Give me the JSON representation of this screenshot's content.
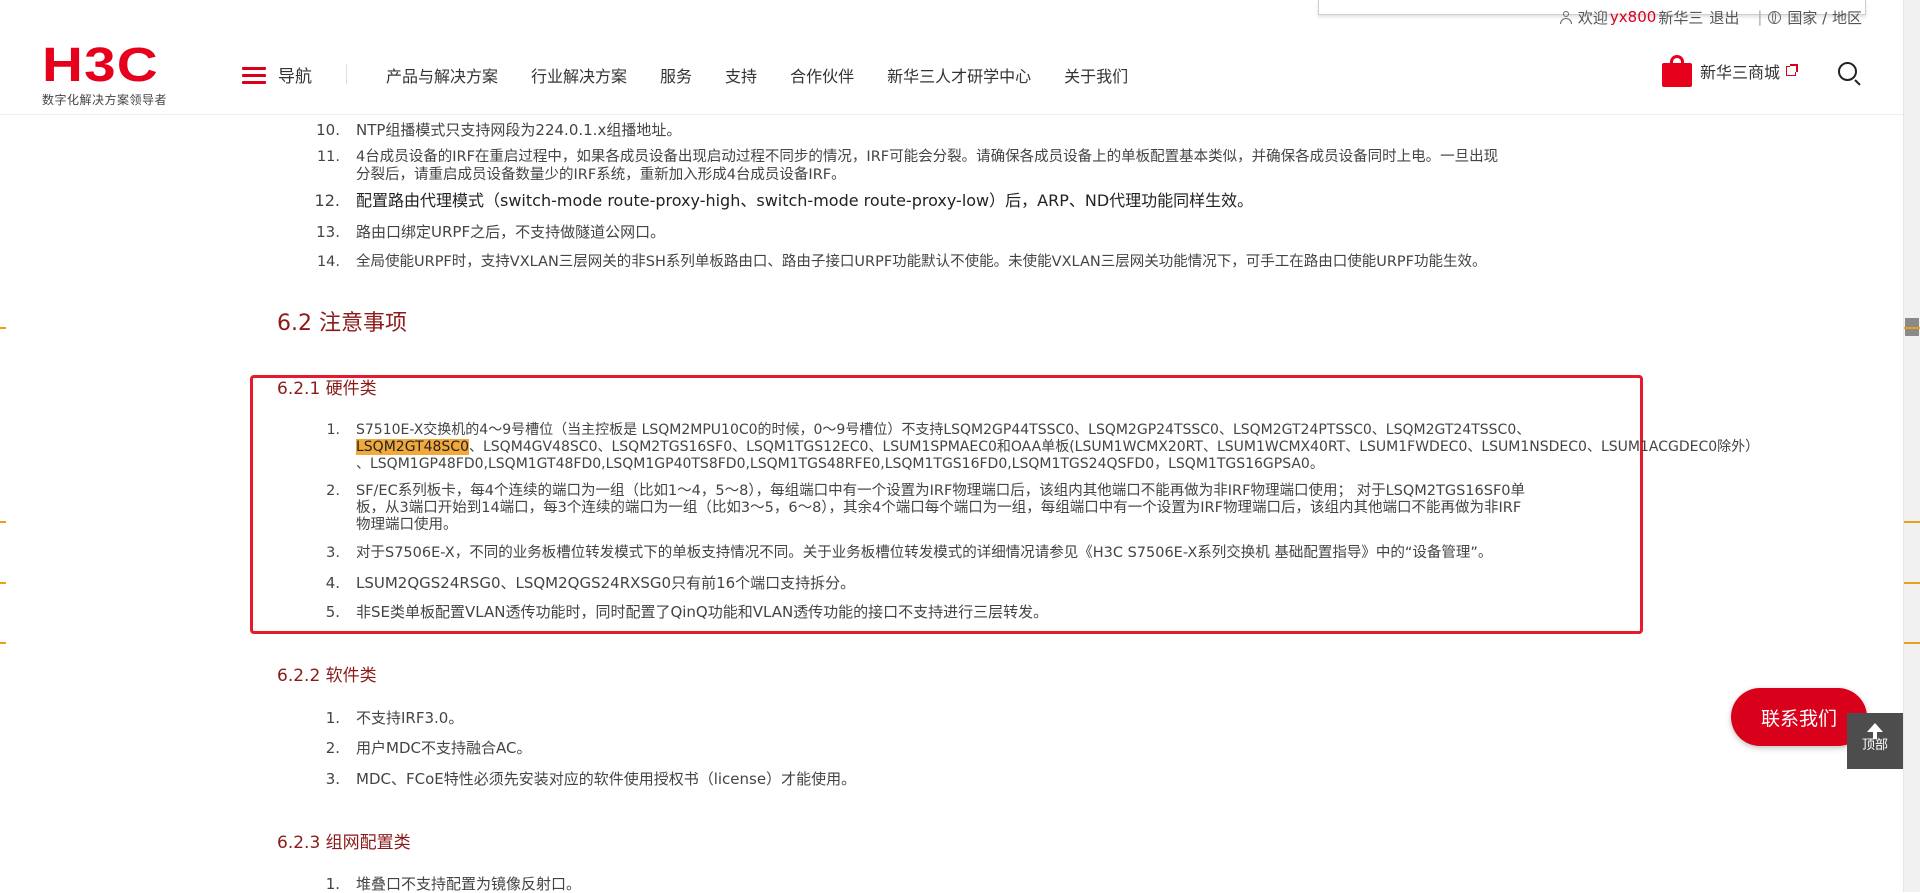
{
  "utility": {
    "welcome": "欢迎",
    "username": "yx800",
    "company": "新华三",
    "logout": "退出",
    "region": "国家 / 地区"
  },
  "header": {
    "logo_text": "H3C",
    "logo_tagline": "数字化解决方案领导者",
    "menu_label": "导航",
    "nav": [
      "产品与解决方案",
      "行业解决方案",
      "服务",
      "支持",
      "合作伙伴",
      "新华三人才研学中心",
      "关于我们"
    ],
    "shop_label": "新华三商城"
  },
  "limits_cont": [
    {
      "num": "10.",
      "text": "NTP组播模式只支持网段为224.0.1.x组播地址。"
    },
    {
      "num": "11.",
      "line1": "4台成员设备的IRF在重启过程中，如果各成员设备出现启动过程不同步的情况，IRF可能会分裂。请确保各成员设备上的单板配置基本类似，并确保各成员设备同时上电。一旦出现",
      "line2": "分裂后，请重启成员设备数量少的IRF系统，重新加入形成4台成员设备IRF。"
    },
    {
      "num": "12.",
      "text": "配置路由代理模式（switch-mode route-proxy-high、switch-mode route-proxy-low）后，ARP、ND代理功能同样生效。"
    },
    {
      "num": "13.",
      "text": "路由口绑定URPF之后，不支持做隧道公网口。"
    },
    {
      "num": "14.",
      "text": "全局使能URPF时，支持VXLAN三层网关的非SH系列单板路由口、路由子接口URPF功能默认不使能。未使能VXLAN三层网关功能情况下，可手工在路由口使能URPF功能生效。"
    }
  ],
  "section": {
    "h2": "6.2  注意事项",
    "hardware_title": "6.2.1  硬件类",
    "software_title": "6.2.2  软件类",
    "network_title": "6.2.3  组网配置类"
  },
  "hardware": {
    "i1_num": "1.",
    "i1_l1": "S7510E-X交换机的4～9号槽位（当主控板是 LSQM2MPU10C0的时候，0～9号槽位）不支持LSQM2GP44TSSC0、LSQM2GP24TSSC0、LSQM2GT24PTSSC0、LSQM2GT24TSSC0、",
    "i1_l2_hl": "LSQM2GT48SC0",
    "i1_l2_rest": "、LSQM4GV48SC0、LSQM2TGS16SF0、LSQM1TGS12EC0、LSUM1SPMAEC0和OAA单板(LSUM1WCMX20RT、LSUM1WCMX40RT、LSUM1FWDEC0、LSUM1NSDEC0、LSUM1ACGDEC0除外）",
    "i1_l3": "、LSQM1GP48FD0,LSQM1GT48FD0,LSQM1GP40TS8FD0,LSQM1TGS48RFE0,LSQM1TGS16FD0,LSQM1TGS24QSFD0，LSQM1TGS16GPSA0。",
    "i2_num": "2.",
    "i2_l1": "SF/EC系列板卡，每4个连续的端口为一组（比如1～4，5～8），每组端口中有一个设置为IRF物理端口后，该组内其他端口不能再做为非IRF物理端口使用；  对于LSQM2TGS16SF0单",
    "i2_l2": "板，从3端口开始到14端口，每3个连续的端口为一组（比如3～5，6～8），其余4个端口每个端口为一组，每组端口中有一个设置为IRF物理端口后，该组内其他端口不能再做为非IRF",
    "i2_l3": "物理端口使用。",
    "i3_num": "3.",
    "i3_text": "对于S7506E-X，不同的业务板槽位转发模式下的单板支持情况不同。关于业务板槽位转发模式的详细情况请参见《H3C S7506E-X系列交换机 基础配置指导》中的“设备管理”。",
    "i4_num": "4.",
    "i4_text": "LSUM2QGS24RSG0、LSQM2QGS24RXSG0只有前16个端口支持拆分。",
    "i5_num": "5.",
    "i5_text": "非SE类单板配置VLAN透传功能时，同时配置了QinQ功能和VLAN透传功能的接口不支持进行三层转发。"
  },
  "software": [
    {
      "num": "1.",
      "text": "不支持IRF3.0。"
    },
    {
      "num": "2.",
      "text": "用户MDC不支持融合AC。"
    },
    {
      "num": "3.",
      "text": "MDC、FCoE特性必须先安装对应的软件使用授权书（license）才能使用。"
    }
  ],
  "network": [
    {
      "num": "1.",
      "text": "堆叠口不支持配置为镜像反射口。"
    }
  ],
  "floating": {
    "contact": "联系我们",
    "top": "顶部"
  },
  "colors": {
    "brand_red": "#e6001c",
    "heading": "#8b1a1a",
    "highlight": "#f2a93b",
    "annotation_box": "#e8192c"
  }
}
